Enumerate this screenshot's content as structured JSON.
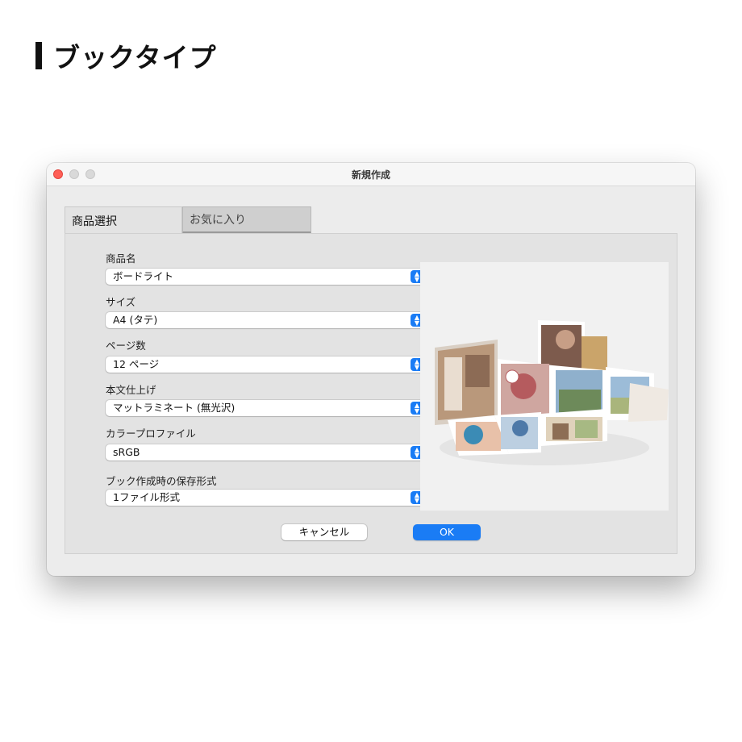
{
  "heading": {
    "text": "ブックタイプ"
  },
  "window": {
    "title": "新規作成"
  },
  "tabs": [
    {
      "label": "商品選択",
      "selected": true
    },
    {
      "label": "お気に入り",
      "selected": false
    }
  ],
  "fields": [
    {
      "label": "商品名",
      "value": "ボードライト"
    },
    {
      "label": "サイズ",
      "value": "A4 (タテ)"
    },
    {
      "label": "ページ数",
      "value": "12 ページ"
    },
    {
      "label": "本文仕上げ",
      "value": "マットラミネート (無光沢)"
    },
    {
      "label": "カラープロファイル",
      "value": "sRGB"
    },
    {
      "label": "ブック作成時の保存形式",
      "value": "1ファイル形式"
    }
  ],
  "buttons": {
    "cancel": "キャンセル",
    "ok": "OK"
  },
  "colors": {
    "accent": "#1a7cf5",
    "close": "#ff5f57"
  },
  "preview": {
    "icon": "photo-book-preview"
  }
}
